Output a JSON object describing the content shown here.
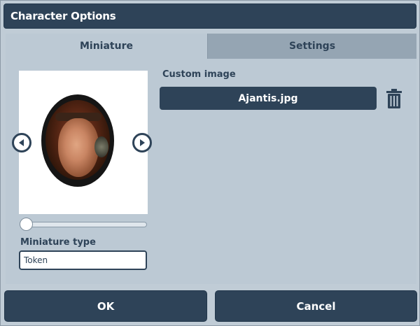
{
  "window": {
    "title": "Character Options"
  },
  "tabs": [
    {
      "label": "Miniature",
      "active": true
    },
    {
      "label": "Settings",
      "active": false
    }
  ],
  "miniature": {
    "portrait_icon": "character-portrait",
    "prev_icon": "arrow-left-circle-icon",
    "next_icon": "arrow-right-circle-icon",
    "scale_slider_value": 0,
    "type_label": "Miniature type",
    "type_value": "Token"
  },
  "custom_image": {
    "label": "Custom image",
    "file_name": "Ajantis.jpg",
    "delete_icon": "trash-icon"
  },
  "footer": {
    "ok_label": "OK",
    "cancel_label": "Cancel"
  },
  "colors": {
    "accent": "#2e4358",
    "panel": "#bcc9d4",
    "inactive_tab": "#95a5b3"
  }
}
